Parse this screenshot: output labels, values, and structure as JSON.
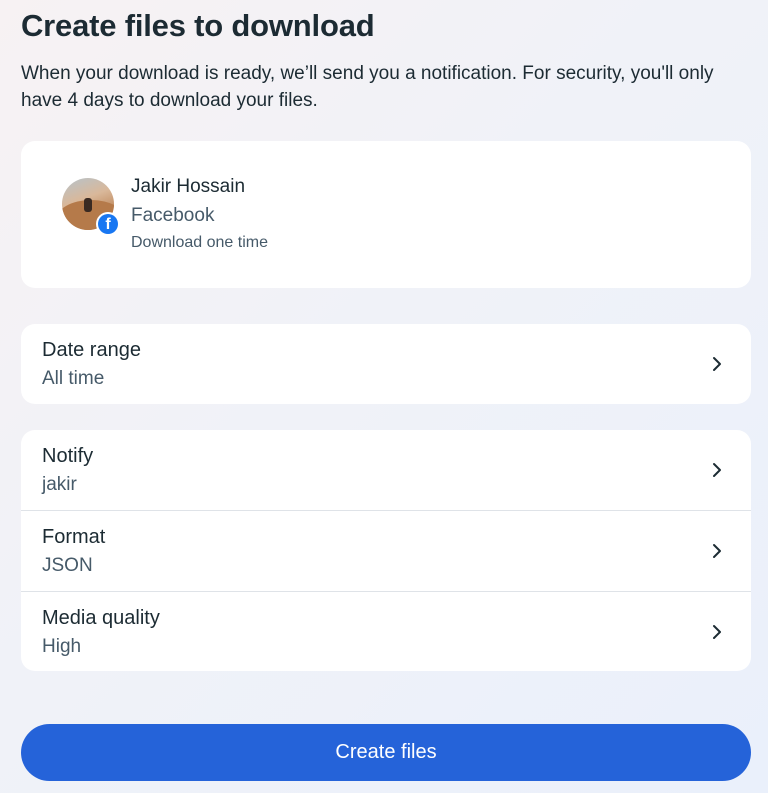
{
  "header": {
    "title": "Create files to download",
    "description": "When your download is ready, we’ll send you a notification. For security, you'll only have 4 days to download your files."
  },
  "account": {
    "name": "Jakir Hossain",
    "platform": "Facebook",
    "note": "Download one time",
    "badge_icon": "facebook-icon",
    "badge_color": "#1877f2"
  },
  "settings": {
    "date_range": {
      "label": "Date range",
      "value": "All time"
    },
    "notify": {
      "label": "Notify",
      "value": "jakir"
    },
    "format": {
      "label": "Format",
      "value": "JSON"
    },
    "media_quality": {
      "label": "Media quality",
      "value": "High"
    }
  },
  "actions": {
    "create_label": "Create files",
    "accent_color": "#2563d9"
  }
}
